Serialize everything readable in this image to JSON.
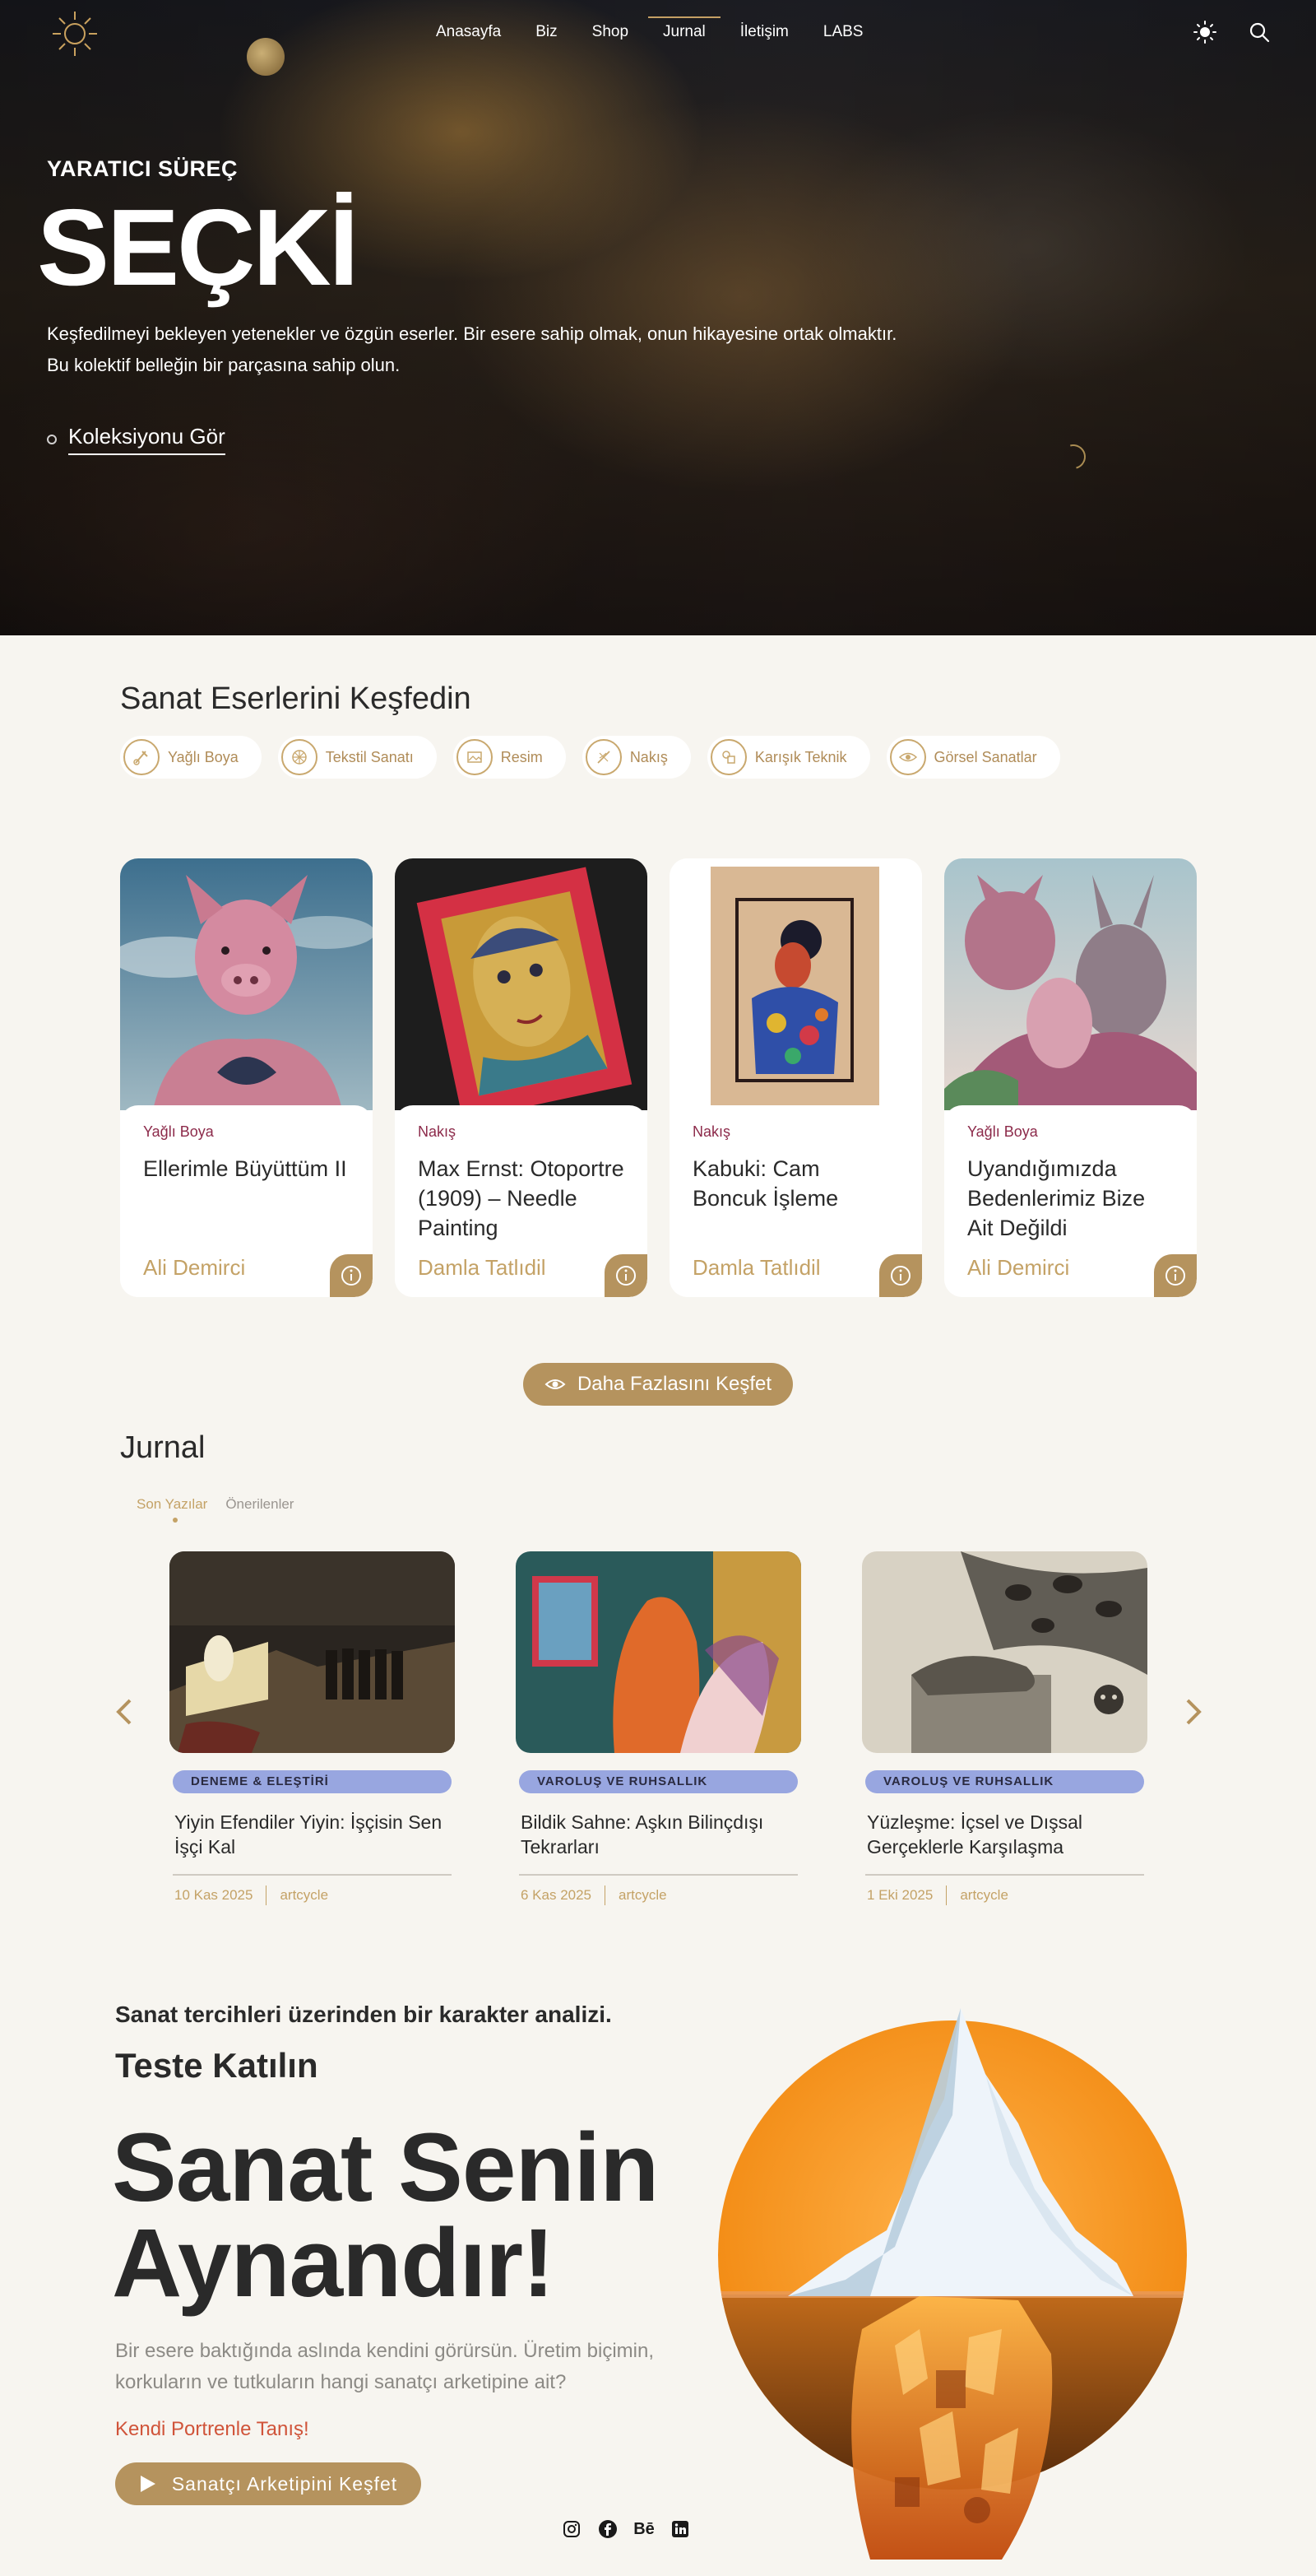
{
  "nav": {
    "links": [
      "Anasayfa",
      "Biz",
      "Shop",
      "Jurnal",
      "İletişim",
      "LABS"
    ],
    "active": "Jurnal",
    "icons": [
      "sun-icon",
      "search-icon"
    ]
  },
  "hero": {
    "eyebrow": "YARATICI SÜREÇ",
    "title": "SEÇKİ",
    "description_line1": "Keşfedilmeyi bekleyen yetenekler ve özgün eserler. Bir esere sahip olmak, onun hikayesine ortak olmaktır.",
    "description_line2": "Bu kolektif belleğin bir parçasına sahip olun.",
    "cta": "Koleksiyonu Gör"
  },
  "explore": {
    "title": "Sanat Eserlerini Keşfedin",
    "categories": [
      "Yağlı Boya",
      "Tekstil Sanatı",
      "Resim",
      "Nakış",
      "Karışık Teknik",
      "Görsel Sanatlar"
    ],
    "cards": [
      {
        "category": "Yağlı Boya",
        "title": "Ellerimle Büyüttüm II",
        "artist": "Ali Demirci"
      },
      {
        "category": "Nakış",
        "title": "Max Ernst: Otoportre (1909) – Needle Painting",
        "artist": "Damla Tatlıdil"
      },
      {
        "category": "Nakış",
        "title": "Kabuki: Cam Boncuk İşleme",
        "artist": "Damla Tatlıdil"
      },
      {
        "category": "Yağlı Boya",
        "title": "Uyandığımızda Bedenlerimiz Bize Ait Değildi",
        "artist": "Ali Demirci"
      }
    ],
    "more_button": "Daha Fazlasını Keşfet"
  },
  "journal": {
    "title": "Jurnal",
    "tabs": [
      "Son Yazılar",
      "Önerilenler"
    ],
    "active_tab": "Son Yazılar",
    "posts": [
      {
        "tag": "DENEME & ELEŞTİRİ",
        "title": "Yiyin Efendiler Yiyin: İşçisin Sen İşçi Kal",
        "date": "10 Kas 2025",
        "author": "artcycle"
      },
      {
        "tag": "VAROLUŞ VE RUHSALLIK",
        "title": "Bildik Sahne: Aşkın Bilinçdışı Tekrarları",
        "date": "6 Kas 2025",
        "author": "artcycle"
      },
      {
        "tag": "VAROLUŞ VE RUHSALLIK",
        "title": "Yüzleşme: İçsel ve Dışsal Gerçeklerle Karşılaşma",
        "date": "1 Eki 2025",
        "author": "artcycle"
      }
    ]
  },
  "quiz": {
    "subtitle": "Sanat tercihleri üzerinden bir karakter analizi.",
    "heading": "Teste Katılın",
    "big_line1": "Sanat Senin",
    "big_line2": "Aynandır!",
    "description": "Bir esere baktığında aslında kendini görürsün. Üretim biçimin, korkuların ve tutkuların hangi sanatçı arketipine ait?",
    "link": "Kendi Portrenle Tanış!",
    "button": "Sanatçı Arketipini Keşfet"
  },
  "socials": {
    "behance_label": "Bē",
    "icons": [
      "instagram-icon",
      "facebook-icon",
      "behance-icon",
      "linkedin-icon"
    ]
  },
  "colors": {
    "accent_gold": "#b5935e",
    "category_wine": "#8c2a4a",
    "tag_blue": "#98a6e0",
    "link_red": "#d0543a",
    "background": "#f7f5f0"
  }
}
